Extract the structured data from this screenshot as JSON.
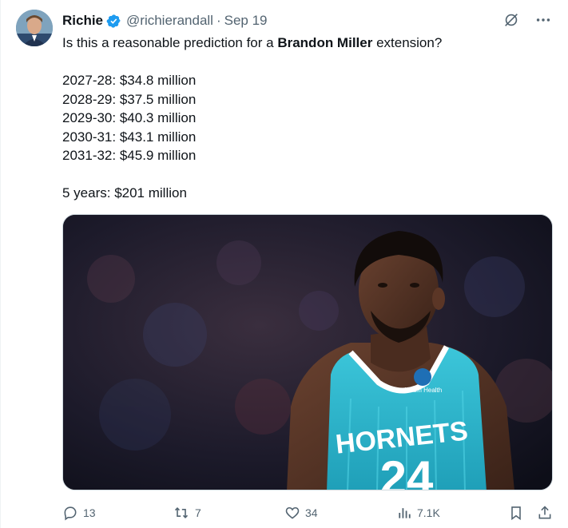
{
  "author": {
    "display_name": "Richie",
    "handle": "@richierandall",
    "separator": "·",
    "date": "Sep 19"
  },
  "tweet": {
    "intro_before": "Is this a reasonable prediction for a ",
    "intro_bold": "Brandon Miller",
    "intro_after": " extension?",
    "lines": [
      "2027-28: $34.8 million",
      "2028-29: $37.5 million",
      "2029-30: $40.3 million",
      "2030-31: $43.1 million",
      "2031-32: $45.9 million"
    ],
    "summary": "5 years: $201 million"
  },
  "media": {
    "jersey_team": "HORNETS",
    "jersey_number": "24",
    "patch_text": "Atrium Health"
  },
  "actions": {
    "replies": "13",
    "reposts": "7",
    "likes": "34",
    "views": "7.1K"
  },
  "colors": {
    "verified": "#1d9bf0",
    "muted": "#536471",
    "jersey": "#2dbcd2"
  },
  "icons": [
    "verified-badge-icon",
    "grok-icon",
    "more-icon",
    "reply-icon",
    "repost-icon",
    "like-icon",
    "views-icon",
    "bookmark-icon",
    "share-icon"
  ]
}
